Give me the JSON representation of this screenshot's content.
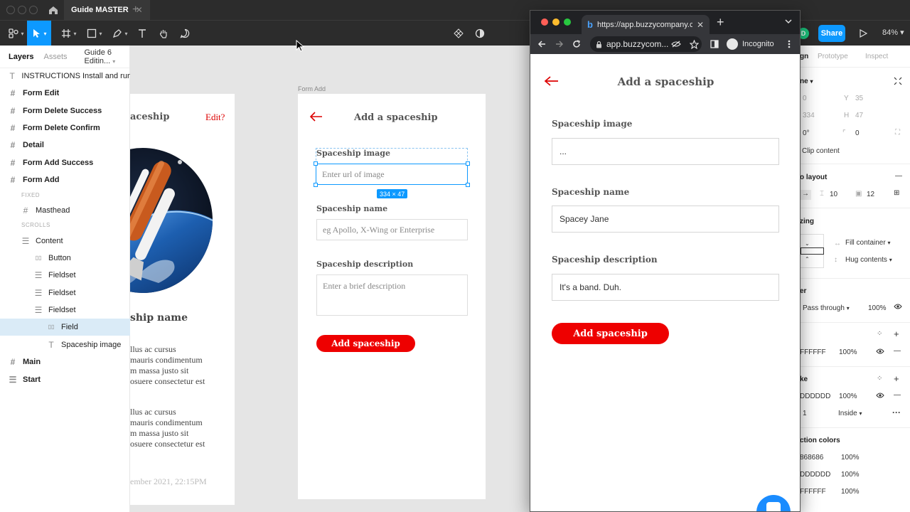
{
  "figma": {
    "document_tab": "Guide MASTER",
    "tab_close": "✕",
    "new_tab": "+",
    "toolbar": {
      "share_label": "Share",
      "zoom": "84%",
      "avatar_initial": "D"
    },
    "layers_panel": {
      "tab_layers": "Layers",
      "tab_assets": "Assets",
      "page_select": "Guide 6 Editin...",
      "items": [
        {
          "icon": "T",
          "label": "INSTRUCTIONS Install and run th..."
        },
        {
          "icon": "#",
          "label": "Form Edit"
        },
        {
          "icon": "#",
          "label": "Form Delete Success"
        },
        {
          "icon": "#",
          "label": "Form Delete Confirm"
        },
        {
          "icon": "#",
          "label": "Detail"
        },
        {
          "icon": "#",
          "label": "Form Add Success"
        },
        {
          "icon": "#",
          "label": "Form Add"
        },
        {
          "icon": "",
          "label": "FIXED"
        },
        {
          "icon": "#",
          "label": "Masthead"
        },
        {
          "icon": "",
          "label": "SCROLLS"
        },
        {
          "icon": "☰",
          "label": "Content"
        },
        {
          "icon": "▯▯",
          "label": "Button"
        },
        {
          "icon": "☰",
          "label": "Fieldset"
        },
        {
          "icon": "☰",
          "label": "Fieldset"
        },
        {
          "icon": "☰",
          "label": "Fieldset"
        },
        {
          "icon": "▯▯",
          "label": "Field"
        },
        {
          "icon": "T",
          "label": "Spaceship image"
        },
        {
          "icon": "#",
          "label": "Main"
        },
        {
          "icon": "☰",
          "label": "Start"
        }
      ]
    },
    "canvas": {
      "detail_frame": {
        "title": "aceship",
        "edit_link": "Edit?",
        "name_heading": "ship name",
        "paragraph_1": [
          "llus ac cursus",
          "mauris condimentum",
          "m massa justo sit",
          "osuere consectetur est"
        ],
        "paragraph_2": [
          "llus ac cursus",
          "mauris condimentum",
          "m massa justo sit",
          "osuere consectetur est"
        ],
        "date": "ember 2021, 22:15PM"
      },
      "form_frame": {
        "frame_label": "Form Add",
        "title": "Add a spaceship",
        "image_label": "Spaceship image",
        "image_placeholder": "Enter url of image",
        "selection_size": "334 × 47",
        "name_label": "Spaceship name",
        "name_placeholder": "eg Apollo, X-Wing or Enterprise",
        "description_label": "Spaceship description",
        "description_placeholder": "Enter a brief description",
        "button_label": "Add spaceship"
      }
    },
    "properties_panel": {
      "tab_design": "gn",
      "tab_prototype": "Prototype",
      "tab_inspect": "Inspect",
      "frame_name": "ne",
      "x_value": "0",
      "y_label": "Y",
      "y_value": "35",
      "w_value": "334",
      "h_label": "H",
      "h_value": "47",
      "rotation": "0°",
      "radius": "0",
      "clip_content": "Clip content",
      "auto_layout": "o layout",
      "gap": "10",
      "padding": "12",
      "resizing": "zing",
      "fill_container": "Fill container",
      "hug_contents": "Hug contents",
      "layer_section": "er",
      "blend_mode": "Pass through",
      "layer_opacity": "100%",
      "fill_hex": "FFFFFF",
      "fill_opacity": "100%",
      "stroke_section": "ke",
      "stroke_hex": "DDDDDD",
      "stroke_opacity": "100%",
      "stroke_weight": "1",
      "stroke_position": "Inside",
      "selection_colors": "ction colors",
      "colors": [
        {
          "hex": "868686",
          "opacity": "100%"
        },
        {
          "hex": "DDDDDD",
          "opacity": "100%"
        },
        {
          "hex": "FFFFFF",
          "opacity": "100%"
        }
      ]
    }
  },
  "browser": {
    "tab_title": "https://app.buzzycompany.com",
    "tab_close": "✕",
    "new_tab": "+",
    "url": "app.buzzycom...",
    "incognito_label": "Incognito",
    "page": {
      "title": "Add a spaceship",
      "image_label": "Spaceship image",
      "image_value": "...",
      "name_label": "Spaceship name",
      "name_value": "Spacey Jane",
      "description_label": "Spaceship description",
      "description_value": "It's a band. Duh.",
      "button_label": "Add spaceship"
    }
  },
  "colors": {
    "figma_dark": "#2c2c2c",
    "figma_blue": "#0d99ff",
    "brand_red": "#ee0000",
    "selected_layer": "#daebf7"
  }
}
